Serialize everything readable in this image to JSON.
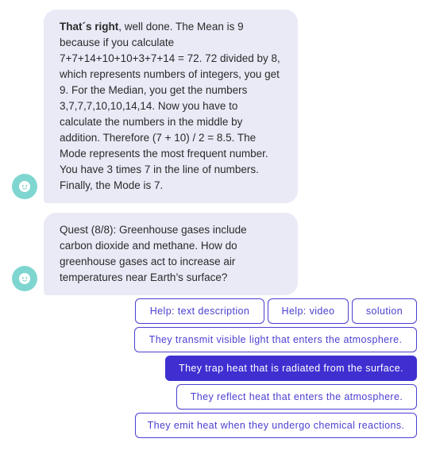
{
  "messages": [
    {
      "bold_prefix": "That´s right",
      "text": ", well done. The Mean is 9 because if you calculate 7+7+14+10+10+3+7+14 = 72. 72 divided by 8, which represents numbers of integers, you get 9. For the Median, you get the numbers 3,7,7,7,10,10,14,14. Now you have to calculate the numbers in the middle by addition. Therefore (7 + 10) / 2 = 8.5. The Mode represents the most frequent number. You have 3 times 7 in the line of numbers. Finally, the Mode is 7."
    },
    {
      "text": "Quest (8/8): Greenhouse gases include carbon dioxide and methane. How do greenhouse gases act to increase air temperatures near Earth’s surface?"
    }
  ],
  "help_buttons": {
    "text_description": "Help: text description",
    "video": "Help: video",
    "solution": "solution"
  },
  "answers": [
    {
      "label": "They transmit visible light that enters the atmosphere.",
      "selected": false
    },
    {
      "label": "They trap heat that is radiated from the surface.",
      "selected": true
    },
    {
      "label": "They reflect heat that enters the atmosphere.",
      "selected": false
    },
    {
      "label": "They emit heat when they undergo chemical reactions.",
      "selected": false
    }
  ],
  "colors": {
    "accent": "#3f2fd1",
    "bubble": "#e9eaf6",
    "avatar": "#7fd6d0"
  },
  "icons": {
    "bot_avatar": "bot-face-icon"
  }
}
